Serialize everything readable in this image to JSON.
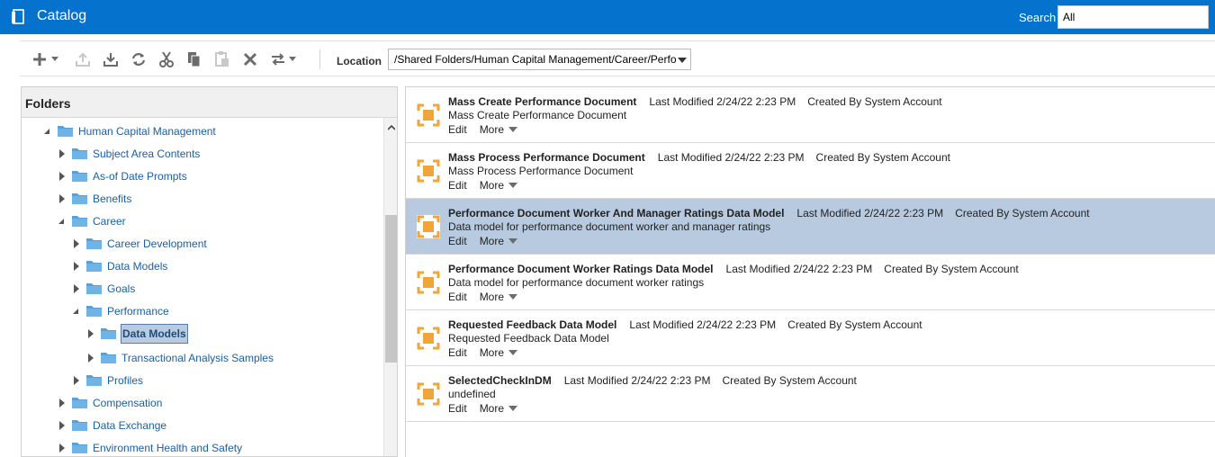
{
  "header": {
    "title": "Catalog",
    "search_label": "Search",
    "search_value": "All"
  },
  "toolbar": {
    "icons": [
      "add-icon",
      "upload-icon",
      "download-icon",
      "refresh-icon",
      "cut-icon",
      "copy-icon",
      "paste-icon",
      "delete-icon",
      "move-icon"
    ],
    "location_label": "Location",
    "location_value": "/Shared Folders/Human Capital Management/Career/Perfo"
  },
  "folders": {
    "title": "Folders",
    "nodes": [
      {
        "label": "Human Capital Management",
        "state": "expanded"
      },
      {
        "label": "Subject Area Contents",
        "state": "collapsed"
      },
      {
        "label": "As-of Date Prompts",
        "state": "collapsed"
      },
      {
        "label": "Benefits",
        "state": "collapsed"
      },
      {
        "label": "Career",
        "state": "expanded"
      },
      {
        "label": "Career Development",
        "state": "collapsed"
      },
      {
        "label": "Data Models",
        "state": "collapsed"
      },
      {
        "label": "Goals",
        "state": "collapsed"
      },
      {
        "label": "Performance",
        "state": "expanded"
      },
      {
        "label": "Data Models",
        "state": "collapsed",
        "selected": true
      },
      {
        "label": "Transactional Analysis Samples",
        "state": "collapsed"
      },
      {
        "label": "Profiles",
        "state": "collapsed"
      },
      {
        "label": "Compensation",
        "state": "collapsed"
      },
      {
        "label": "Data Exchange",
        "state": "collapsed"
      },
      {
        "label": "Environment Health and Safety",
        "state": "collapsed"
      }
    ]
  },
  "results": {
    "edit_label": "Edit",
    "more_label": "More",
    "items": [
      {
        "name": "Mass Create Performance Document",
        "modified": "Last Modified 2/24/22 2:23 PM",
        "created": "Created By System Account",
        "description": "Mass Create Performance Document"
      },
      {
        "name": "Mass Process Performance Document",
        "modified": "Last Modified 2/24/22 2:23 PM",
        "created": "Created By System Account",
        "description": "Mass Process Performance Document"
      },
      {
        "name": "Performance Document Worker And Manager Ratings Data Model",
        "modified": "Last Modified 2/24/22 2:23 PM",
        "created": "Created By System Account",
        "description": "Data model for performance document worker and manager ratings",
        "selected": true
      },
      {
        "name": "Performance Document Worker Ratings Data Model",
        "modified": "Last Modified 2/24/22 2:23 PM",
        "created": "Created By System Account",
        "description": "Data model for performance document worker ratings"
      },
      {
        "name": "Requested Feedback Data Model",
        "modified": "Last Modified 2/24/22 2:23 PM",
        "created": "Created By System Account",
        "description": "Requested Feedback Data Model"
      },
      {
        "name": "SelectedCheckInDM",
        "modified": "Last Modified 2/24/22 2:23 PM",
        "created": "Created By System Account",
        "description": "undefined"
      }
    ]
  }
}
